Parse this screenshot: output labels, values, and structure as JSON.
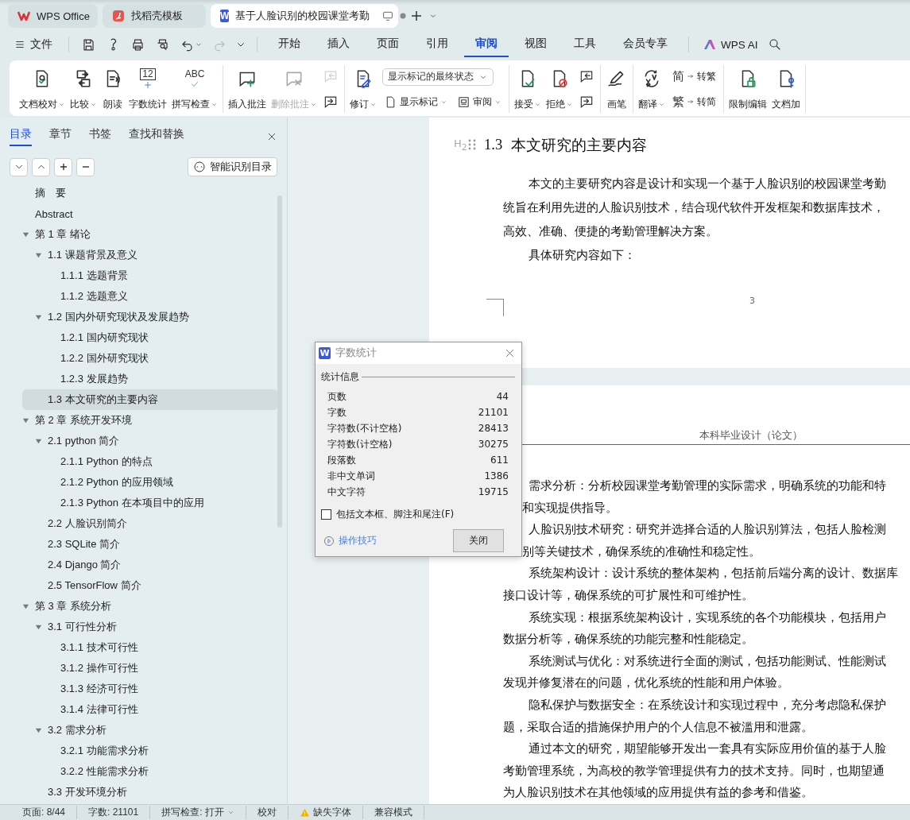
{
  "title_tabs": [
    {
      "label": "WPS Office",
      "selected": false,
      "kind": "wps"
    },
    {
      "label": "找稻壳模板",
      "selected": false,
      "kind": "docer"
    },
    {
      "label": "基于人脸识别的校园课堂考勤",
      "selected": true,
      "kind": "writer",
      "badge": "W"
    }
  ],
  "menu": {
    "file": "文件",
    "tabs": [
      {
        "label": "开始",
        "selected": false
      },
      {
        "label": "插入",
        "selected": false
      },
      {
        "label": "页面",
        "selected": false
      },
      {
        "label": "引用",
        "selected": false
      },
      {
        "label": "审阅",
        "selected": true
      },
      {
        "label": "视图",
        "selected": false
      },
      {
        "label": "工具",
        "selected": false
      },
      {
        "label": "会员专享",
        "selected": false
      }
    ],
    "ai": "WPS AI"
  },
  "ribbon": [
    {
      "columns": [
        {
          "kind": "large",
          "label": "文档校对",
          "dropdown": true,
          "disabled": false
        },
        {
          "kind": "large",
          "label": "比较",
          "dropdown": true,
          "disabled": false
        },
        {
          "kind": "large",
          "label": "朗读",
          "dropdown": false,
          "disabled": false
        },
        {
          "kind": "large",
          "label": "字数统计",
          "dropdown": false,
          "disabled": false,
          "icon_text": "12"
        },
        {
          "kind": "large",
          "label": "拼写检查",
          "dropdown": true,
          "disabled": false,
          "icon_text": "ABC"
        }
      ]
    },
    {
      "columns": [
        {
          "kind": "large",
          "label": "插入批注",
          "dropdown": false,
          "disabled": false
        },
        {
          "kind": "large",
          "label": "删除批注",
          "dropdown": true,
          "disabled": true
        },
        {
          "kind": "stack",
          "rows": [
            [
              {
                "kind": "icon",
                "disabled": true
              }
            ],
            [
              {
                "kind": "icon",
                "disabled": false
              }
            ]
          ]
        }
      ]
    },
    {
      "columns": [
        {
          "kind": "large",
          "label": "修订",
          "dropdown": true,
          "disabled": false
        },
        {
          "kind": "stack",
          "rows": [
            [
              {
                "kind": "select",
                "value": "显示标记的最终状态"
              }
            ],
            [
              {
                "kind": "small",
                "label": "显示标记",
                "dropdown": true,
                "disabled": false
              },
              {
                "kind": "small",
                "label": "审阅",
                "dropdown": true,
                "disabled": false
              }
            ]
          ]
        }
      ]
    },
    {
      "columns": [
        {
          "kind": "large",
          "label": "接受",
          "dropdown": true,
          "disabled": false
        },
        {
          "kind": "large",
          "label": "拒绝",
          "dropdown": true,
          "disabled": false
        },
        {
          "kind": "stack",
          "rows": [
            [
              {
                "kind": "icon",
                "disabled": false
              }
            ],
            [
              {
                "kind": "icon",
                "disabled": false
              }
            ]
          ]
        }
      ]
    },
    {
      "columns": [
        {
          "kind": "large",
          "label": "画笔",
          "dropdown": false,
          "disabled": false
        }
      ]
    },
    {
      "columns": [
        {
          "kind": "large",
          "label": "翻译",
          "dropdown": true,
          "disabled": false
        },
        {
          "kind": "stack",
          "rows": [
            [
              {
                "kind": "small",
                "label": "转繁",
                "dropdown": false,
                "disabled": false,
                "icon_text": "简"
              }
            ],
            [
              {
                "kind": "small",
                "label": "转简",
                "dropdown": false,
                "disabled": false,
                "icon_text": "繁"
              }
            ]
          ]
        }
      ]
    },
    {
      "columns": [
        {
          "kind": "large",
          "label": "限制编辑",
          "dropdown": false,
          "disabled": false
        },
        {
          "kind": "large",
          "label": "文档加",
          "dropdown": false,
          "disabled": false
        }
      ]
    }
  ],
  "sidebar": {
    "tabs": [
      {
        "label": "目录",
        "selected": true
      },
      {
        "label": "章节",
        "selected": false
      },
      {
        "label": "书签",
        "selected": false
      },
      {
        "label": "查找和替换",
        "selected": false
      }
    ],
    "detect_button": "智能识别目录",
    "toc": [
      {
        "label": "摘　要",
        "selected": false
      },
      {
        "label": "Abstract",
        "selected": false
      },
      {
        "label": "第 1 章  绪论",
        "selected": false,
        "expanded": true,
        "children": [
          {
            "label": "1.1 课题背景及意义",
            "selected": false,
            "expanded": true,
            "children": [
              {
                "label": "1.1.1  选题背景",
                "selected": false
              },
              {
                "label": "1.1.2  选题意义",
                "selected": false
              }
            ]
          },
          {
            "label": "1.2  国内外研究现状及发展趋势",
            "selected": false,
            "expanded": true,
            "children": [
              {
                "label": "1.2.1  国内研究现状",
                "selected": false
              },
              {
                "label": "1.2.2  国外研究现状",
                "selected": false
              },
              {
                "label": "1.2.3  发展趋势",
                "selected": false
              }
            ]
          },
          {
            "label": "1.3  本文研究的主要内容",
            "selected": true
          }
        ]
      },
      {
        "label": "第 2 章  系统开发环境",
        "selected": false,
        "expanded": true,
        "children": [
          {
            "label": "2.1 python 简介",
            "selected": false,
            "expanded": true,
            "children": [
              {
                "label": "2.1.1 Python 的特点",
                "selected": false
              },
              {
                "label": "2.1.2 Python 的应用领域",
                "selected": false
              },
              {
                "label": "2.1.3 Python 在本项目中的应用",
                "selected": false
              }
            ]
          },
          {
            "label": "2.2  人脸识别简介",
            "selected": false
          },
          {
            "label": "2.3 SQLite 简介",
            "selected": false
          },
          {
            "label": "2.4 Django 简介",
            "selected": false
          },
          {
            "label": "2.5 TensorFlow 简介",
            "selected": false
          }
        ]
      },
      {
        "label": "第 3 章  系统分析",
        "selected": false,
        "expanded": true,
        "children": [
          {
            "label": "3.1  可行性分析",
            "selected": false,
            "expanded": true,
            "children": [
              {
                "label": "3.1.1  技术可行性",
                "selected": false
              },
              {
                "label": "3.1.2  操作可行性",
                "selected": false
              },
              {
                "label": "3.1.3  经济可行性",
                "selected": false
              },
              {
                "label": "3.1.4  法律可行性",
                "selected": false
              }
            ]
          },
          {
            "label": "3.2 需求分析",
            "selected": false,
            "expanded": true,
            "children": [
              {
                "label": "3.2.1  功能需求分析",
                "selected": false
              },
              {
                "label": "3.2.2  性能需求分析",
                "selected": false
              }
            ]
          },
          {
            "label": "3.3 开发环境分析",
            "selected": false
          }
        ]
      }
    ]
  },
  "document": {
    "heading_marker": "H$_{2}$",
    "heading_number": "1.3",
    "heading": "本文研究的主要内容",
    "page1_lines": [
      {
        "kind": "indent",
        "text": "本文的主要研究内容是设计和实现一个基于人脸识别的校园课堂考勤"
      },
      {
        "kind": "plain",
        "text": "统旨在利用先进的人脸识别技术，结合现代软件开发框架和数据库技术，"
      },
      {
        "kind": "plain",
        "text": "高效、准确、便捷的考勤管理解决方案。"
      },
      {
        "kind": "indent",
        "text": "具体研究内容如下："
      }
    ],
    "page_number": "3",
    "page_header": "本科毕业设计（论文）",
    "page2_lines": [
      {
        "kind": "indent",
        "text": "需求分析：分析校园课堂考勤管理的实际需求，明确系统的功能和特"
      },
      {
        "kind": "offset",
        "text": "和实现提供指导。"
      },
      {
        "kind": "indent",
        "text": "人脸识别技术研究：研究并选择合适的人脸识别算法，包括人脸检测"
      },
      {
        "kind": "offset",
        "text": "别等关键技术，确保系统的准确性和稳定性。"
      },
      {
        "kind": "indent",
        "text": "系统架构设计：设计系统的整体架构，包括前后端分离的设计、数据库"
      },
      {
        "kind": "plain",
        "text": "接口设计等，确保系统的可扩展性和可维护性。"
      },
      {
        "kind": "indent",
        "text": "系统实现：根据系统架构设计，实现系统的各个功能模块，包括用户"
      },
      {
        "kind": "plain",
        "text": "数据分析等，确保系统的功能完整和性能稳定。"
      },
      {
        "kind": "indent",
        "text": "系统测试与优化：对系统进行全面的测试，包括功能测试、性能测试"
      },
      {
        "kind": "plain",
        "text": "发现并修复潜在的问题，优化系统的性能和用户体验。"
      },
      {
        "kind": "indent",
        "text": "隐私保护与数据安全：在系统设计和实现过程中，充分考虑隐私保护"
      },
      {
        "kind": "plain",
        "text": "题，采取合适的措施保护用户的个人信息不被滥用和泄露。"
      },
      {
        "kind": "indent",
        "text": "通过本文的研究，期望能够开发出一套具有实际应用价值的基于人脸"
      },
      {
        "kind": "plain",
        "text": "考勤管理系统，为高校的教学管理提供有力的技术支持。同时，也期望通"
      },
      {
        "kind": "plain",
        "text": "为人脸识别技术在其他领域的应用提供有益的参考和借鉴。"
      }
    ]
  },
  "dialog": {
    "badge": "W",
    "title": "字数统计",
    "group": "统计信息",
    "rows": [
      {
        "label": "页数",
        "value": "44"
      },
      {
        "label": "字数",
        "value": "21101"
      },
      {
        "label": "字符数(不计空格)",
        "value": "28413"
      },
      {
        "label": "字符数(计空格)",
        "value": "30275"
      },
      {
        "label": "段落数",
        "value": "611"
      },
      {
        "label": "非中文单词",
        "value": "1386"
      },
      {
        "label": "中文字符",
        "value": "19715"
      }
    ],
    "checkbox": {
      "label": "包括文本框、脚注和尾注(F)",
      "checked": false
    },
    "tips_link": "操作技巧",
    "close_button": "关闭"
  },
  "status_bar": [
    {
      "kind": "text",
      "text": "页面: 8/44"
    },
    {
      "kind": "text",
      "text": "字数: 21101"
    },
    {
      "kind": "dropdown",
      "text": "拼写检查: 打开"
    },
    {
      "kind": "text",
      "text": "校对"
    },
    {
      "kind": "warning",
      "text": "缺失字体"
    },
    {
      "kind": "text",
      "text": "兼容模式"
    }
  ]
}
